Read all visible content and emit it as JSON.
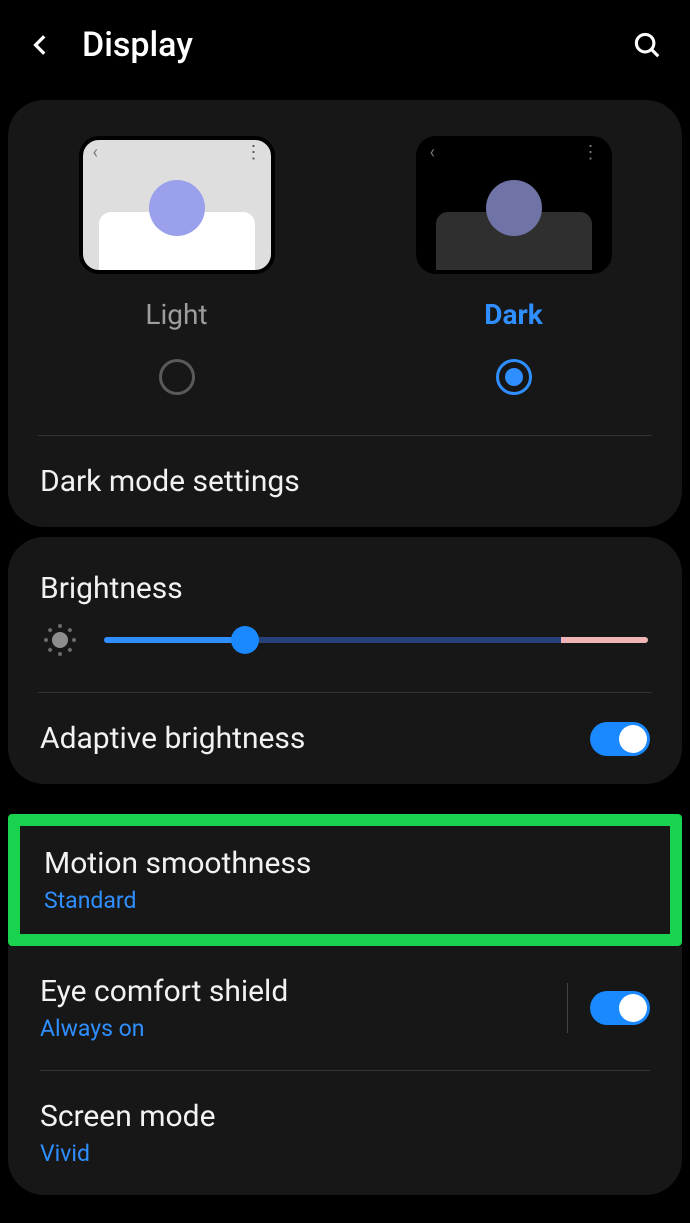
{
  "header": {
    "title": "Display"
  },
  "theme": {
    "light_label": "Light",
    "dark_label": "Dark",
    "selected": "dark"
  },
  "dark_mode_settings_label": "Dark mode settings",
  "brightness": {
    "label": "Brightness",
    "value_percent": 26,
    "warn_start_percent": 84
  },
  "adaptive_brightness": {
    "label": "Adaptive brightness",
    "enabled": true
  },
  "motion_smoothness": {
    "label": "Motion smoothness",
    "value": "Standard",
    "highlighted": true
  },
  "eye_comfort": {
    "label": "Eye comfort shield",
    "value": "Always on",
    "enabled": true
  },
  "screen_mode": {
    "label": "Screen mode",
    "value": "Vivid"
  },
  "colors": {
    "accent": "#2f8fff",
    "highlight": "#19d24e"
  }
}
